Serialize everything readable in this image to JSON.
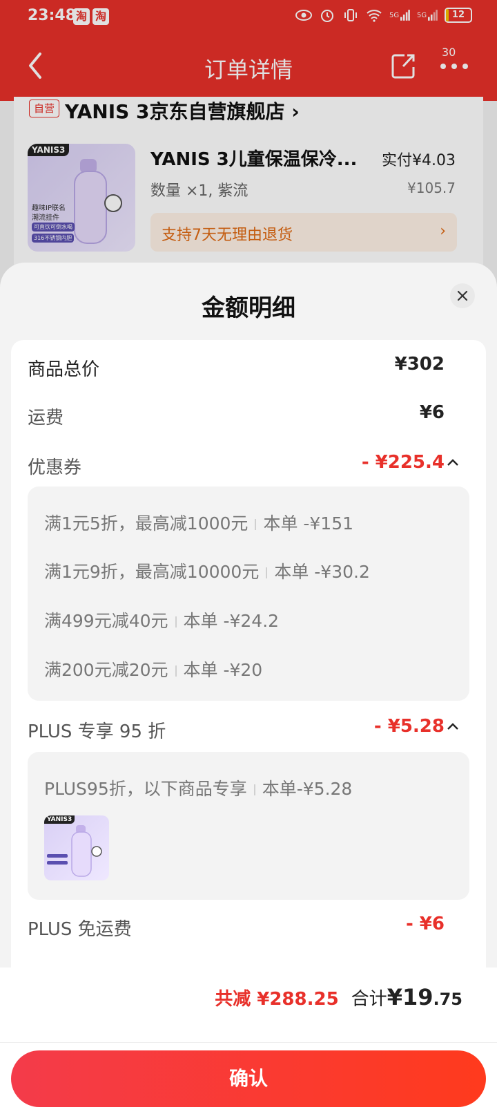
{
  "status_bar": {
    "time": "23:48",
    "app_badges": [
      "淘",
      "淘"
    ],
    "network": [
      "5G",
      "5G"
    ],
    "battery": "12"
  },
  "nav": {
    "title": "订单详情",
    "more_badge": "30"
  },
  "store": {
    "tag": "自营",
    "name": "YANIS 3京东自营旗舰店 ›",
    "product": {
      "name": "YANIS 3儿童保温保冷...",
      "paid_label": "实付¥4.03",
      "spec": "数量 ×1, 紫流",
      "original_price": "¥105.7",
      "return_policy": "支持7天无理由退货",
      "return_arrow": "›",
      "thumb_brand": "YANIS3",
      "thumb_lines": [
        "趣味IP联名",
        "潮流挂件",
        "可直饮可倒水喝",
        "316不锈钢内胆"
      ]
    }
  },
  "sheet": {
    "title": "金额明细",
    "rows": {
      "goods_total": {
        "label": "商品总价",
        "value": "¥302"
      },
      "shipping": {
        "label": "运费",
        "value": "¥6"
      },
      "coupon": {
        "label": "优惠券",
        "value": "- ¥225.4"
      },
      "plus_discount": {
        "label": "PLUS 专享 95 折",
        "value": "- ¥5.28"
      },
      "plus_shipping": {
        "label": "PLUS 免运费",
        "value": "- ¥6"
      }
    },
    "coupons": [
      {
        "rule": "满1元5折，最高减1000元",
        "amount": "本单 -¥151"
      },
      {
        "rule": "满1元9折，最高减10000元",
        "amount": "本单 -¥30.2"
      },
      {
        "rule": "满499元减40元",
        "amount": "本单 -¥24.2"
      },
      {
        "rule": "满200元减20元",
        "amount": "本单 -¥20"
      }
    ],
    "plus_detail": {
      "rule": "PLUS95折，以下商品专享",
      "amount": "本单-¥5.28",
      "thumb_brand": "YANIS3"
    }
  },
  "footer": {
    "total_discount": "共减 ¥288.25",
    "total_label": "合计 ",
    "total_int": "¥19",
    "total_dec": ".75",
    "confirm": "确认"
  },
  "colors": {
    "brand_red": "#e8302a",
    "header_red": "#e8302a",
    "return_orange": "#e06a14",
    "button_gradient_start": "#f43b4a",
    "button_gradient_end": "#ff3a1d"
  }
}
